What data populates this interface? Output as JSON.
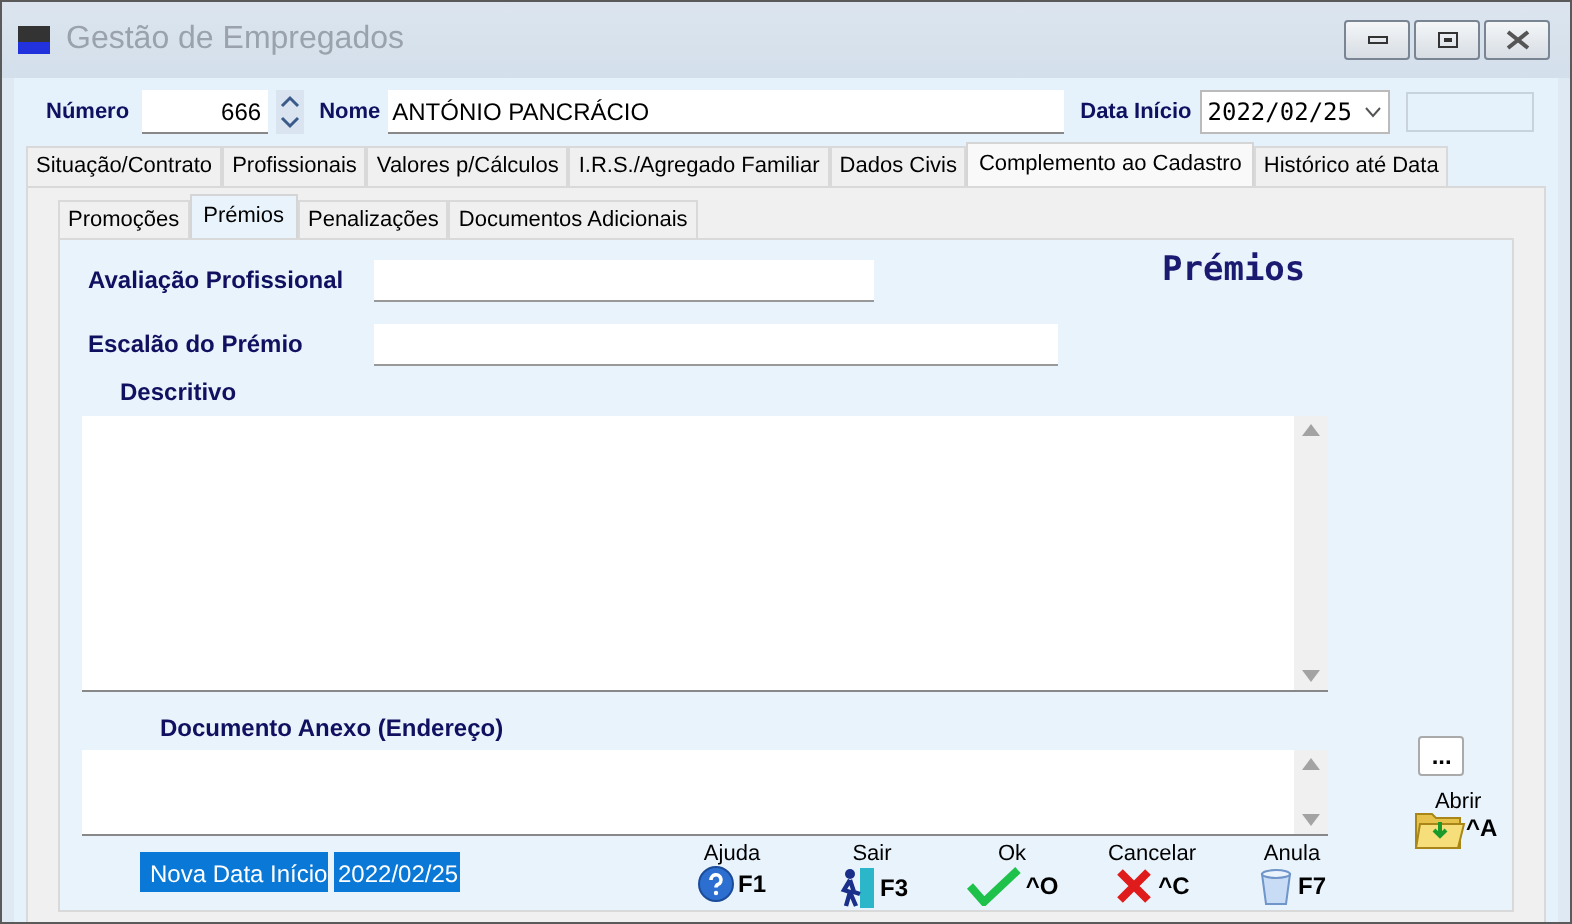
{
  "window": {
    "title": "Gestão de Empregados"
  },
  "header": {
    "number": {
      "label": "Número",
      "value": "666"
    },
    "name": {
      "label": "Nome",
      "value": "ANTÓNIO PANCRÁCIO"
    },
    "start_date": {
      "label": "Data Início",
      "value": "2022/02/25"
    }
  },
  "tabs": [
    {
      "label": "Situação/Contrato",
      "selected": false
    },
    {
      "label": "Profissionais",
      "selected": false
    },
    {
      "label": "Valores p/Cálculos",
      "selected": false
    },
    {
      "label": "I.R.S./Agregado Familiar",
      "selected": false
    },
    {
      "label": "Dados Civis",
      "selected": false
    },
    {
      "label": "Complemento ao Cadastro",
      "selected": true
    },
    {
      "label": "Histórico até Data",
      "selected": false
    }
  ],
  "subtabs": [
    {
      "label": "Promoções",
      "selected": false
    },
    {
      "label": "Prémios",
      "selected": true
    },
    {
      "label": "Penalizações",
      "selected": false
    },
    {
      "label": "Documentos Adicionais",
      "selected": false
    }
  ],
  "form": {
    "heading": "Prémios",
    "fields": [
      {
        "label": "Avaliação Profissional"
      },
      {
        "label": "Escalão do Prémio"
      }
    ],
    "description": {
      "label": "Descritivo"
    },
    "attachment": {
      "label": "Documento Anexo (Endereço)",
      "browse": "...",
      "open": {
        "label": "Abrir",
        "shortcut": "^A"
      }
    },
    "new_start": {
      "label": "Nova Data Início",
      "value": "2022/02/25"
    }
  },
  "actions": [
    {
      "kind": "help",
      "label": "Ajuda",
      "shortcut": "F1"
    },
    {
      "kind": "exit",
      "label": "Sair",
      "shortcut": "F3"
    },
    {
      "kind": "ok",
      "label": "Ok",
      "shortcut": "^O"
    },
    {
      "kind": "cancel",
      "label": "Cancelar",
      "shortcut": "^C"
    },
    {
      "kind": "undo",
      "label": "Anula",
      "shortcut": "F7"
    }
  ]
}
